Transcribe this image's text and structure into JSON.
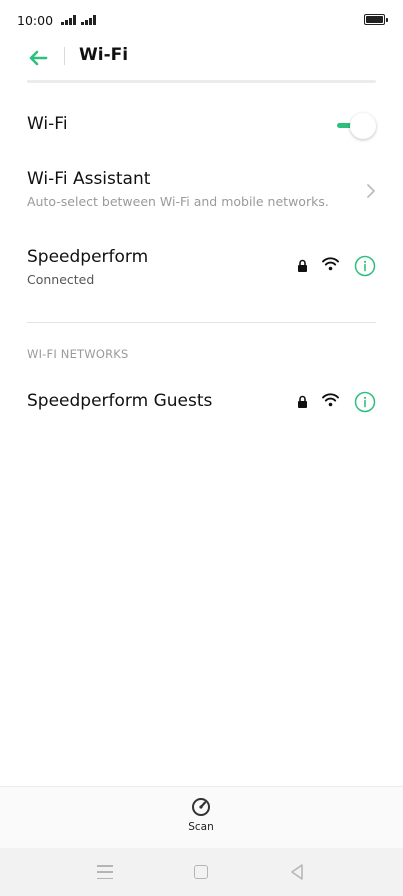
{
  "status_bar": {
    "time": "10:00"
  },
  "header": {
    "title": "Wi-Fi",
    "back_icon": "arrow-left-icon"
  },
  "wifi_toggle": {
    "label": "Wi-Fi",
    "state": "on"
  },
  "wifi_assistant": {
    "title": "Wi-Fi Assistant",
    "subtitle": "Auto-select between Wi-Fi and mobile networks."
  },
  "connected_network": {
    "name": "Speedperform",
    "status": "Connected",
    "secured": true
  },
  "networks_section": {
    "header": "WI-FI NETWORKS",
    "items": [
      {
        "name": "Speedperform Guests",
        "secured": true
      }
    ]
  },
  "bottom_bar": {
    "scan_label": "Scan",
    "scan_icon": "speedometer-icon"
  },
  "colors": {
    "accent": "#2fbf7c",
    "text_primary": "#111111",
    "text_secondary": "#9a9a9a"
  }
}
